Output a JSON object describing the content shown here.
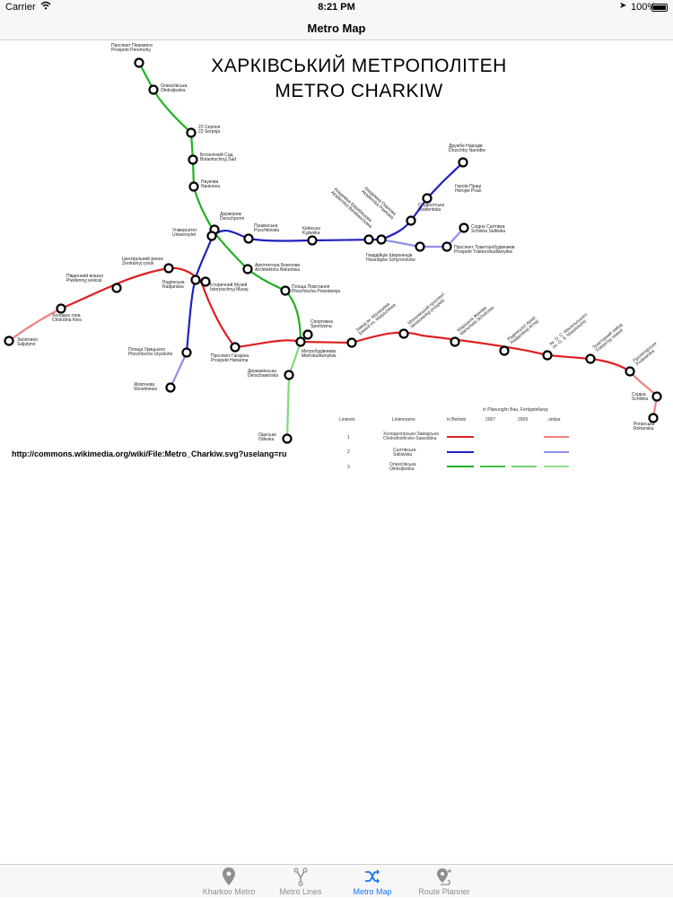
{
  "status_bar": {
    "carrier": "Carrier",
    "time": "8:21 PM",
    "battery": "100%"
  },
  "nav": {
    "title": "Metro Map"
  },
  "map": {
    "title_line1": "ХАРКІВСЬКИЙ МЕТРОПОЛІТЕН",
    "title_line2": "METRO CHARKIW",
    "source_url": "http://commons.wikimedia.org/wiki/File:Metro_Charkiw.svg?uselang=ru",
    "line_colors": {
      "red": "#e02020",
      "blue": "#2020c0",
      "green": "#20b020",
      "planned_red": "#f08080",
      "planned_blue": "#9090e8",
      "planned_green": "#80d880"
    },
    "stations": {
      "peremohy": [
        "Проспект Перемоги",
        "Prospekt Peremohy"
      ],
      "oleksiivska": [
        "Олексіївська",
        "Oleksijiwska"
      ],
      "serpnia": [
        "23 Серпня",
        "23 Serpnja"
      ],
      "botsad": [
        "Ботанічний Сад",
        "Botanitschnyj Sad"
      ],
      "naukova": [
        "Наукова",
        "Naukowa"
      ],
      "derzhprom": [
        "Держпром",
        "Derschprom"
      ],
      "universytet": [
        "Університет",
        "Uniwersytet"
      ],
      "pushkinska": [
        "Пушкінська",
        "Puschkinska"
      ],
      "kyivska": [
        "Київська",
        "Kyjiwska"
      ],
      "akademika_barabashova": [
        "Академіка Барабашова",
        "Akademika Barabaschowa"
      ],
      "akademika_pavlova": [
        "Академіка Павлова",
        "Akademika Pawlowa"
      ],
      "studentska": [
        "Студентська",
        "Studentska"
      ],
      "heroiv_pratsi": [
        "Героїв Праці",
        "Herojiw Prazi"
      ],
      "druzhby_narodiv": [
        "Дружби Народів",
        "Druschby Narodiw"
      ],
      "skhidna_saltivka": [
        "Східна Салтівка",
        "Schidna Saltiwka"
      ],
      "traktorobud": [
        "Проспект Тракторобудівників",
        "Prospekt Traktorobudiwnykiw"
      ],
      "shyronintsiv": [
        "Гвардійців Широнінців",
        "Hwardijziw Schyroninziw"
      ],
      "arkhitektora": [
        "Архітектора Бекетова",
        "Architektora Beketowa"
      ],
      "povstannia": [
        "Площа Повстання",
        "Ploschtscha Powstannja"
      ],
      "tsentralnyi_rynok": [
        "Центральний ринок",
        "Zentralnyj rynok"
      ],
      "pivdennyi": [
        "Південний вокзал",
        "Piwdennyj wokzal"
      ],
      "radianska": [
        "Радянська",
        "Radjanska"
      ],
      "istorychnyi": [
        "Історичний Музей",
        "Istorytschnyj Musej"
      ],
      "kholodna_hora": [
        "Холодна гора",
        "Cholodna hora"
      ],
      "zalyutyno": [
        "Залютино",
        "Saljutyno"
      ],
      "urytskoho": [
        "Площа Урицького",
        "Ploschtscha Uryzkoho"
      ],
      "zhovtneva": [
        "Жовтнева",
        "Showtnewa"
      ],
      "haharina": [
        "Проспект Гагаріна",
        "Prospekt Haharina"
      ],
      "sportyvna": [
        "Спортивна",
        "Sportywna"
      ],
      "metrobudivnykiv": [
        "Метробудівників",
        "Metrobudiwnykiw"
      ],
      "derzhavinska": [
        "Державінська",
        "Derschawinska"
      ],
      "odeska": [
        "Одеська",
        "Odeska"
      ],
      "malysheva": [
        "Завод ім. Малишева",
        "Sawod im. Malyschewa"
      ],
      "moskovskyi": [
        "Московський проспект",
        "Moskowskyj prospekt"
      ],
      "marshala_zhukova": [
        "Маршала Жукова",
        "Marschala Schukowa"
      ],
      "radianskoi_armii": [
        "Радянської Армії",
        "Radjanskoji Armiji"
      ],
      "maselskoho": [
        "Ім. О. С. Масельського",
        "im. O. S. Maselskoho"
      ],
      "traktornyi_zavod": [
        "Тракторний завод",
        "Traktornyj sawod"
      ],
      "proletarska": [
        "Пролетарська",
        "Proletarska"
      ],
      "skhidna": [
        "Східна",
        "Schidna"
      ],
      "rohanska": [
        "Роганська",
        "Rohanska"
      ]
    },
    "legend": {
      "header_plan": "in Planung/in Bau, Fertigstellung:",
      "col_nr": "Liniennr.",
      "col_name": "Linienname",
      "col_betrieb": "in Betrieb",
      "col_2007": "2007",
      "col_2009": "2009",
      "col_unklar": "unklar",
      "rows": [
        {
          "nr": "1",
          "name1": "Холодногірсько-Заводська",
          "name2": "Cholodnohirsko-Sawodska"
        },
        {
          "nr": "2",
          "name1": "Салтівська",
          "name2": "Saltiwska"
        },
        {
          "nr": "3",
          "name1": "Олексіївська",
          "name2": "Oleksijiwska"
        }
      ]
    }
  },
  "tabs": [
    {
      "label": "Kharkov Metro",
      "icon": "map-pin-icon",
      "active": false
    },
    {
      "label": "Metro Lines",
      "icon": "lines-graph-icon",
      "active": false
    },
    {
      "label": "Metro Map",
      "icon": "shuffle-icon",
      "active": true
    },
    {
      "label": "Route Planner",
      "icon": "route-pin-icon",
      "active": false
    }
  ]
}
